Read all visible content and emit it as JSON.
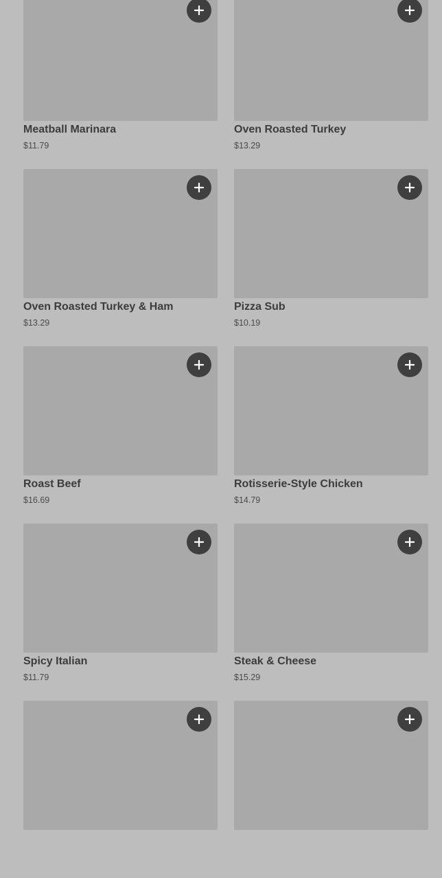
{
  "menu": {
    "items": [
      {
        "name": "Meatball Marinara",
        "price": "$11.79",
        "add_icon": "plus-icon"
      },
      {
        "name": "Oven Roasted Turkey",
        "price": "$13.29",
        "add_icon": "plus-icon"
      },
      {
        "name": "Oven Roasted Turkey & Ham",
        "price": "$13.29",
        "add_icon": "plus-icon"
      },
      {
        "name": "Pizza Sub",
        "price": "$10.19",
        "add_icon": "plus-icon"
      },
      {
        "name": "Roast Beef",
        "price": "$16.69",
        "add_icon": "plus-icon"
      },
      {
        "name": "Rotisserie-Style Chicken",
        "price": "$14.79",
        "add_icon": "plus-icon"
      },
      {
        "name": "Spicy Italian",
        "price": "$11.79",
        "add_icon": "plus-icon"
      },
      {
        "name": "Steak & Cheese",
        "price": "$15.29",
        "add_icon": "plus-icon"
      },
      {
        "name": "",
        "price": "",
        "add_icon": "plus-icon"
      },
      {
        "name": "",
        "price": "",
        "add_icon": "plus-icon"
      }
    ]
  },
  "colors": {
    "background": "#bdbdbd",
    "image_placeholder": "#a9a9a9",
    "add_button": "#3f3f3f",
    "text": "#3c3c3c"
  }
}
